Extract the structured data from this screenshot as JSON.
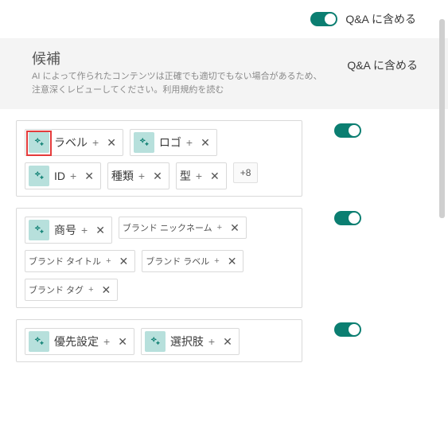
{
  "colors": {
    "accent": "#0b7e71",
    "highlight": "#e43b3b",
    "badge": "#b7e0dc"
  },
  "top": {
    "toggle_label": "Q&A に含める"
  },
  "header": {
    "title": "候補",
    "sub_line1": "AI によって作られたコンテンツは正確でも適切でもない場合があるため、",
    "sub_line2_prefix": "注意深くレビューしてください。",
    "sub_link": "利用規約を読む",
    "right_label": "Q&A に含める"
  },
  "cards": [
    {
      "chips": [
        {
          "label": "ラベル",
          "ai": true,
          "style": "tall",
          "highlight": true
        },
        {
          "label": "ロゴ",
          "ai": true,
          "style": "tall"
        },
        {
          "label": "ID",
          "ai": true,
          "style": "tall"
        },
        {
          "label": "種類",
          "ai": false,
          "style": "tall"
        },
        {
          "label": "型",
          "ai": false,
          "style": "tall"
        }
      ],
      "more": "+8"
    },
    {
      "chips": [
        {
          "label": "商号",
          "ai": true,
          "style": "tall"
        },
        {
          "label": "ブランド ニックネーム",
          "ai": false,
          "style": "small"
        },
        {
          "label": "ブランド タイトル",
          "ai": false,
          "style": "small"
        },
        {
          "label": "ブランド ラベル",
          "ai": false,
          "style": "small"
        },
        {
          "label": "ブランド タグ",
          "ai": false,
          "style": "small"
        }
      ],
      "more": null
    },
    {
      "chips": [
        {
          "label": "優先設定",
          "ai": true,
          "style": "tall"
        },
        {
          "label": "選択肢",
          "ai": true,
          "style": "tall"
        }
      ],
      "more": null
    }
  ]
}
